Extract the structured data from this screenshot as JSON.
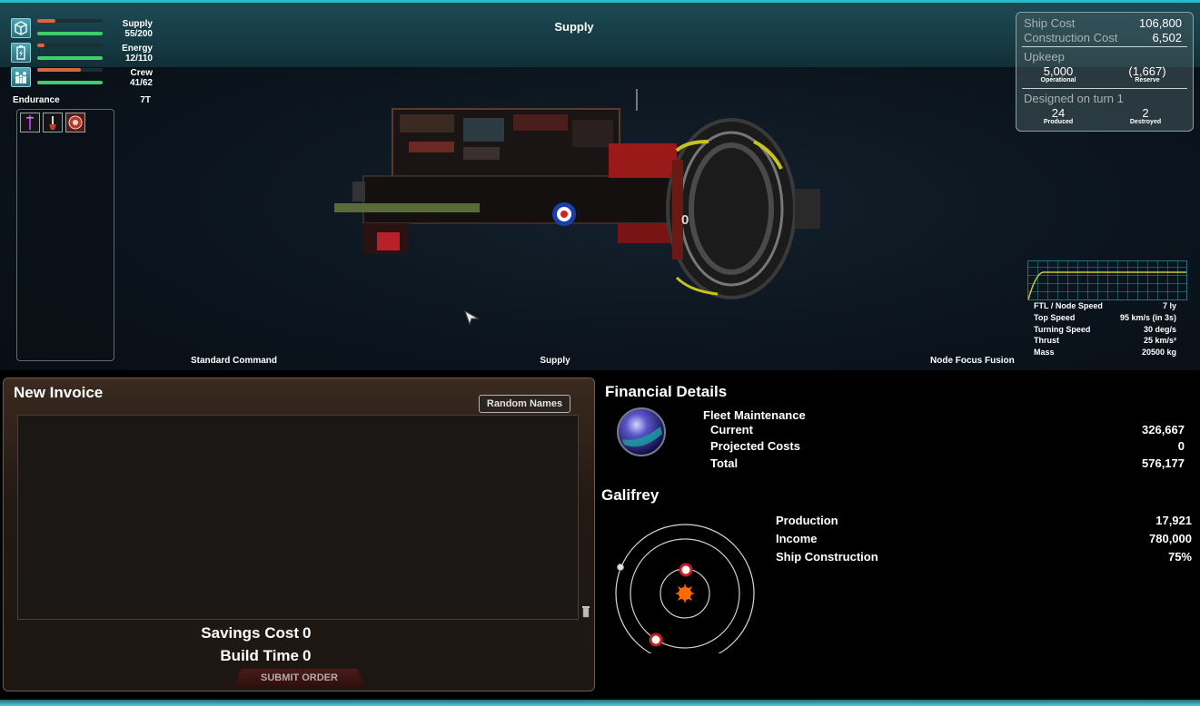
{
  "header": {
    "title": "Supply"
  },
  "resources": {
    "supply": {
      "label": "Supply",
      "value": "55/200",
      "fill": 0.275
    },
    "energy": {
      "label": "Energy",
      "value": "12/110",
      "fill": 0.11
    },
    "crew": {
      "label": "Crew",
      "value": "41/62",
      "fill": 0.66
    }
  },
  "endurance": {
    "label": "Endurance",
    "value": "7T"
  },
  "costs": {
    "ship_cost_label": "Ship Cost",
    "ship_cost": "106,800",
    "construction_cost_label": "Construction Cost",
    "construction_cost": "6,502",
    "upkeep_label": "Upkeep",
    "operational": "5,000",
    "operational_label": "Operational",
    "reserve": "(1,667)",
    "reserve_label": "Reserve",
    "designed_label": "Designed on turn 1",
    "produced": "24",
    "produced_label": "Produced",
    "destroyed": "2",
    "destroyed_label": "Destroyed"
  },
  "ship": {
    "label_number": "0"
  },
  "speed": [
    {
      "label": "FTL / Node Speed",
      "value": "7 ly"
    },
    {
      "label": "Top Speed",
      "value": "95 km/s (in 3s)"
    },
    {
      "label": "Turning Speed",
      "value": "30 deg/s"
    },
    {
      "label": "Thrust",
      "value": "25 km/s²"
    },
    {
      "label": "Mass",
      "value": "20500 kg"
    }
  ],
  "bottom_labels": {
    "left": "Standard Command",
    "center": "Supply",
    "right": "Node Focus Fusion"
  },
  "invoice": {
    "title": "New Invoice",
    "random_names": "Random Names",
    "savings_label": "Savings Cost",
    "savings_value": "0",
    "build_label": "Build Time",
    "build_value": "0",
    "submit": "SUBMIT ORDER"
  },
  "financial": {
    "title": "Financial Details",
    "fleet_maintenance": "Fleet Maintenance",
    "current_label": "Current",
    "current": "326,667",
    "projected_label": "Projected Costs",
    "projected": "0",
    "total_label": "Total",
    "total": "576,177"
  },
  "planet": {
    "name": "Galifrey",
    "production_label": "Production",
    "production": "17,921",
    "income_label": "Income",
    "income": "780,000",
    "construction_label": "Ship Construction",
    "construction": "75%"
  },
  "colors": {
    "accent": "#2fb8c8",
    "bar_green": "#3fcf6a",
    "bar_red": "#d8673d"
  },
  "icons": [
    "supply-icon",
    "energy-icon",
    "crew-icon",
    "cursor-icon",
    "trash-icon",
    "sun-icon",
    "empire-globe-icon"
  ]
}
